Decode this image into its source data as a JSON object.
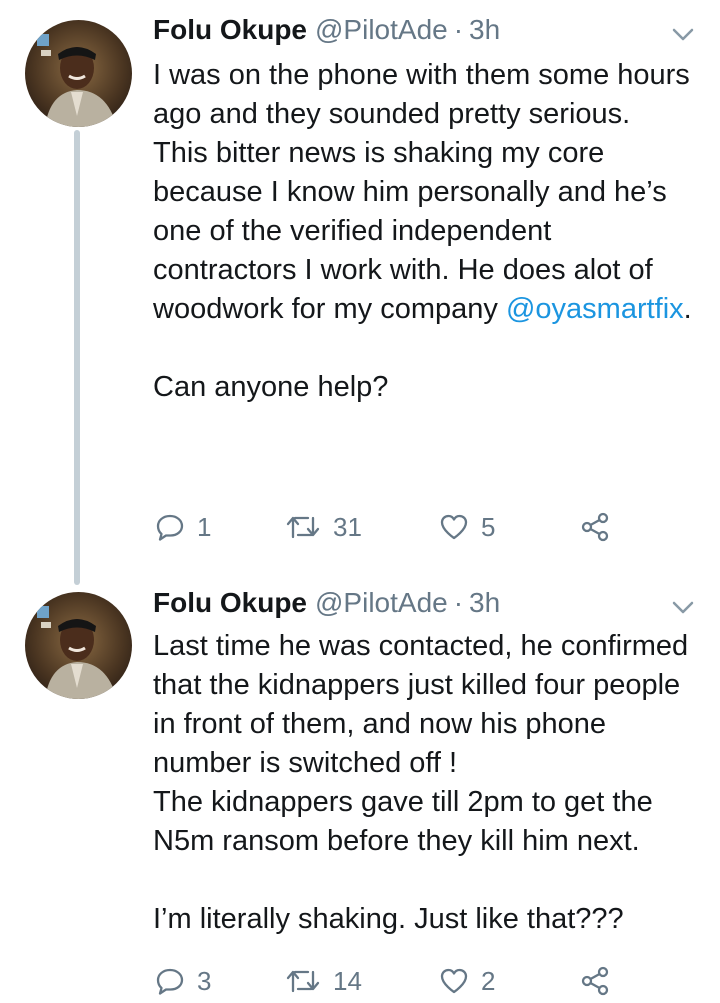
{
  "tweets": [
    {
      "author": {
        "name": "Folu Okupe",
        "handle": "@PilotAde",
        "separator": "·",
        "time": "3h"
      },
      "text": {
        "p1": "I was on the phone with them some hours ago and they sounded pretty serious.",
        "p2": "This bitter news is shaking my core because I know him personally and he’s one of the verified independent contractors I work with. He does alot of woodwork for my company",
        "mention": "@oyasmartfix",
        "period": ".",
        "p3": "Can anyone help?"
      },
      "stats": {
        "replies": "1",
        "retweets": "31",
        "likes": "5"
      }
    },
    {
      "author": {
        "name": "Folu Okupe",
        "handle": "@PilotAde",
        "separator": "·",
        "time": "3h"
      },
      "text": {
        "p1": "Last time he was contacted, he confirmed that the kidnappers just killed four people in front of them, and now his phone number is switched off !",
        "p2": "The kidnappers gave till 2pm to get the N5m ransom before they kill him next.",
        "p3": "I’m literally shaking. Just like that???"
      },
      "stats": {
        "replies": "3",
        "retweets": "14",
        "likes": "2"
      }
    }
  ],
  "icons": {
    "reply": "reply-icon",
    "retweet": "retweet-icon",
    "like": "heart-icon",
    "share": "share-icon",
    "menu": "chevron-down-icon"
  },
  "colors": {
    "text": "#14171a",
    "muted": "#657786",
    "link": "#1b95e0",
    "thread_line": "#c4cfd6"
  }
}
